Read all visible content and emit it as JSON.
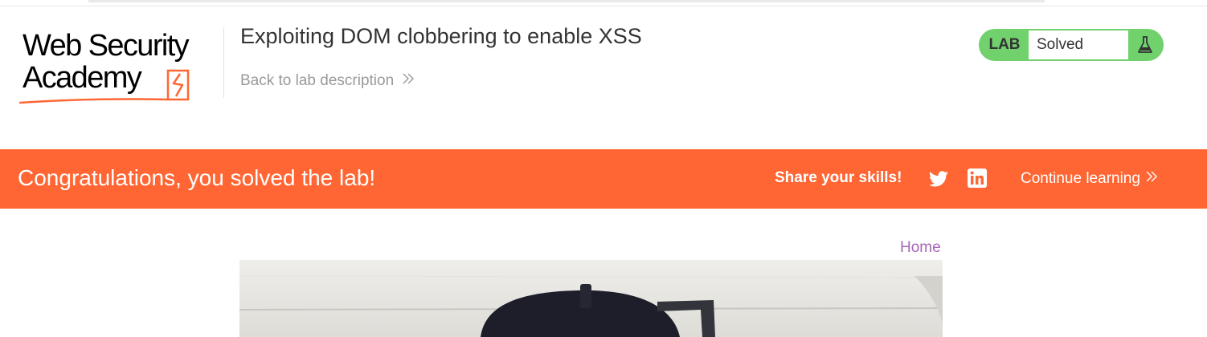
{
  "header": {
    "logo_line1": "Web Security",
    "logo_line2": "Academy",
    "lab_title": "Exploiting DOM clobbering to enable XSS",
    "back_link": "Back to lab description",
    "back_icon": "double-chevron-right-icon"
  },
  "status": {
    "tag": "LAB",
    "value": "Solved",
    "icon": "flask-icon",
    "color": "#70d16d"
  },
  "banner": {
    "message": "Congratulations, you solved the lab!",
    "share_label": "Share your skills!",
    "twitter_icon": "twitter-icon",
    "linkedin_icon": "linkedin-icon",
    "continue_label": "Continue learning",
    "color": "#ff6633"
  },
  "nav": {
    "home_label": "Home",
    "link_color": "#a666b6"
  },
  "hero": {
    "image": "blog-hero-photo"
  }
}
